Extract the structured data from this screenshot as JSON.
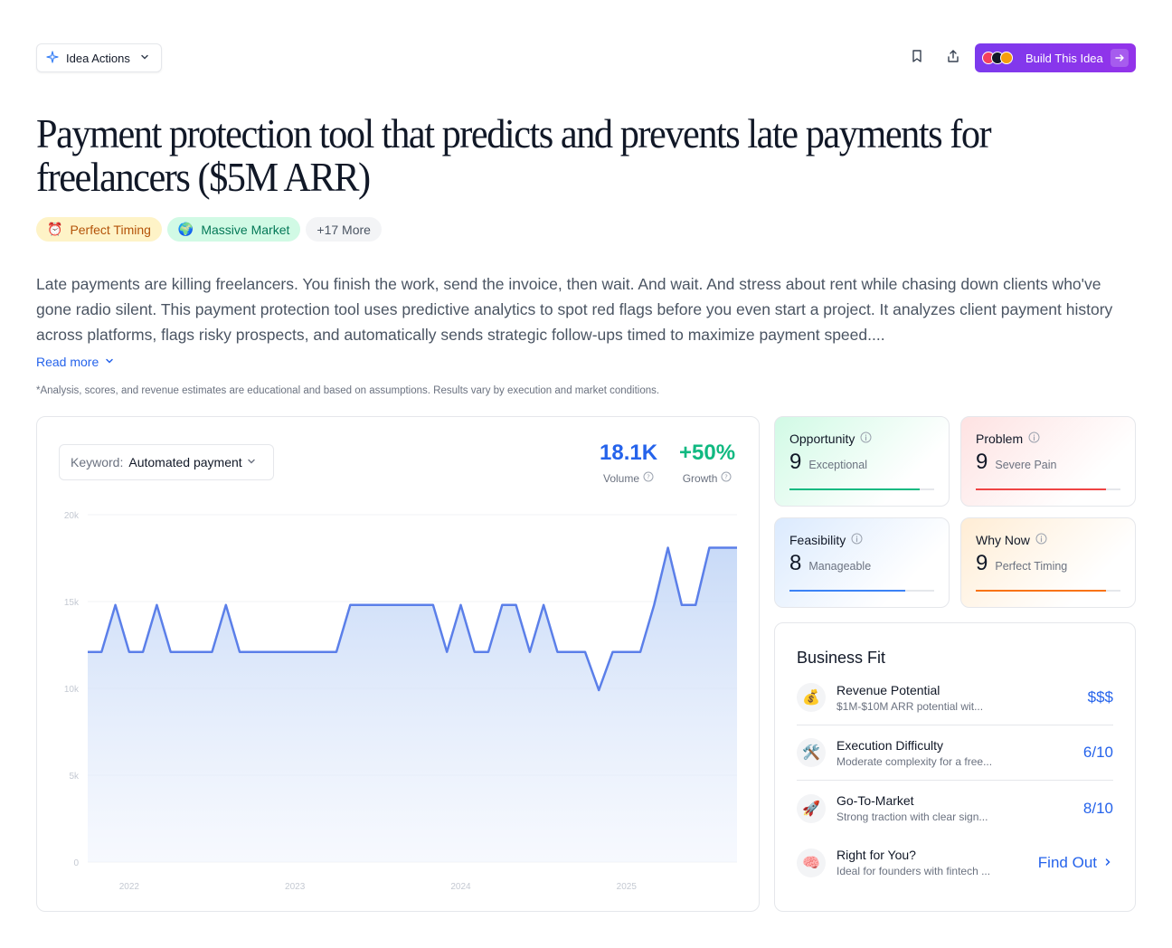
{
  "toolbar": {
    "idea_actions_label": "Idea Actions",
    "build_label": "Build This Idea"
  },
  "title": "Payment protection tool that predicts and prevents late payments for freelancers ($5M ARR)",
  "tags": [
    {
      "icon": "⏰",
      "label": "Perfect Timing"
    },
    {
      "icon": "🌍",
      "label": "Massive Market"
    },
    {
      "label": "+17 More"
    }
  ],
  "description": "Late payments are killing freelancers. You finish the work, send the invoice, then wait. And wait. And stress about rent while chasing down clients who've gone radio silent. This payment protection tool uses predictive analytics to spot red flags before you even start a project. It analyzes client payment history across platforms, flags risky prospects, and automatically sends strategic follow-ups timed to maximize payment speed....",
  "read_more": "Read more",
  "disclaimer": "*Analysis, scores, and revenue estimates are educational and based on assumptions. Results vary by execution and market conditions.",
  "keyword": {
    "label": "Keyword:",
    "value": "Automated payment"
  },
  "stats": {
    "volume": {
      "value": "18.1K",
      "label": "Volume"
    },
    "growth": {
      "value": "+50%",
      "label": "Growth"
    }
  },
  "metrics": [
    {
      "title": "Opportunity",
      "score": "9",
      "desc": "Exceptional",
      "fill": 0.9,
      "color": "#10b981"
    },
    {
      "title": "Problem",
      "score": "9",
      "desc": "Severe Pain",
      "fill": 0.9,
      "color": "#ef4444"
    },
    {
      "title": "Feasibility",
      "score": "8",
      "desc": "Manageable",
      "fill": 0.8,
      "color": "#3b82f6"
    },
    {
      "title": "Why Now",
      "score": "9",
      "desc": "Perfect Timing",
      "fill": 0.9,
      "color": "#f97316"
    }
  ],
  "business_fit": {
    "title": "Business Fit",
    "rows": [
      {
        "icon": "💰",
        "name": "Revenue Potential",
        "sub": "$1M-$10M ARR potential wit...",
        "value": "$$$"
      },
      {
        "icon": "🛠️",
        "name": "Execution Difficulty",
        "sub": "Moderate complexity for a free...",
        "value": "6/10"
      },
      {
        "icon": "🚀",
        "name": "Go-To-Market",
        "sub": "Strong traction with clear sign...",
        "value": "8/10"
      },
      {
        "icon": "🧠",
        "name": "Right for You?",
        "sub": "Ideal for founders with fintech ...",
        "value": "Find Out"
      }
    ]
  },
  "colors": {
    "accent": "#2563eb",
    "brand": "#7c3aed",
    "line": "#5b7fe9"
  },
  "chart_data": {
    "type": "area",
    "x": [
      "2021-10",
      "2021-11",
      "2021-12",
      "2022-01",
      "2022-02",
      "2022-03",
      "2022-04",
      "2022-05",
      "2022-06",
      "2022-07",
      "2022-08",
      "2022-09",
      "2022-10",
      "2022-11",
      "2022-12",
      "2023-01",
      "2023-02",
      "2023-03",
      "2023-04",
      "2023-05",
      "2023-06",
      "2023-07",
      "2023-08",
      "2023-09",
      "2023-10",
      "2023-11",
      "2023-12",
      "2024-01",
      "2024-02",
      "2024-03",
      "2024-04",
      "2024-05",
      "2024-06",
      "2024-07",
      "2024-08",
      "2024-09",
      "2024-10",
      "2024-11",
      "2024-12",
      "2025-01",
      "2025-02",
      "2025-03",
      "2025-04",
      "2025-05",
      "2025-06",
      "2025-07",
      "2025-08",
      "2025-09"
    ],
    "values": [
      12100,
      12100,
      14800,
      12100,
      12100,
      14800,
      12100,
      12100,
      12100,
      12100,
      14800,
      12100,
      12100,
      12100,
      12100,
      12100,
      12100,
      12100,
      12100,
      14800,
      14800,
      14800,
      14800,
      14800,
      14800,
      14800,
      12100,
      14800,
      12100,
      12100,
      14800,
      14800,
      12100,
      14800,
      12100,
      12100,
      12100,
      9900,
      12100,
      12100,
      12100,
      14800,
      18100,
      14800,
      14800,
      18100,
      18100,
      18100
    ],
    "xticks": [
      "2022",
      "2023",
      "2024",
      "2025"
    ],
    "yticks": [
      "0",
      "5k",
      "10k",
      "15k",
      "20k"
    ],
    "ylim": [
      0,
      20000
    ],
    "grid": true
  }
}
